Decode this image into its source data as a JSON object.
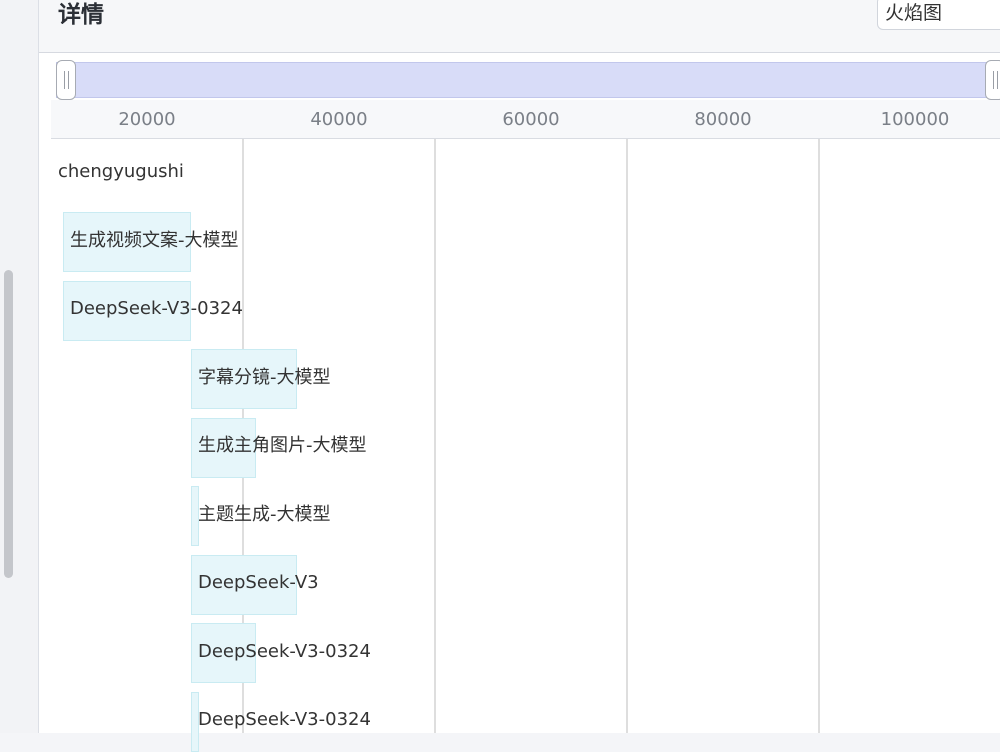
{
  "header": {
    "title": "详情",
    "view_select": "火焰图"
  },
  "axis": {
    "ticks": [
      "20000",
      "40000",
      "60000",
      "80000",
      "100000"
    ]
  },
  "flame": {
    "root": "chengyugushi",
    "rows": [
      {
        "label": "生成视频文案-大模型"
      },
      {
        "label": "DeepSeek-V3-0324"
      },
      {
        "label": "字幕分镜-大模型"
      },
      {
        "label": "生成主角图片-大模型"
      },
      {
        "label": "主题生成-大模型"
      },
      {
        "label": "DeepSeek-V3"
      },
      {
        "label": "DeepSeek-V3-0324"
      },
      {
        "label": "DeepSeek-V3-0324"
      }
    ]
  },
  "colors": {
    "bar_fill": "#e6f6fa",
    "bar_border": "#c9ebf2",
    "zoom_fill": "#d8dcf8"
  }
}
